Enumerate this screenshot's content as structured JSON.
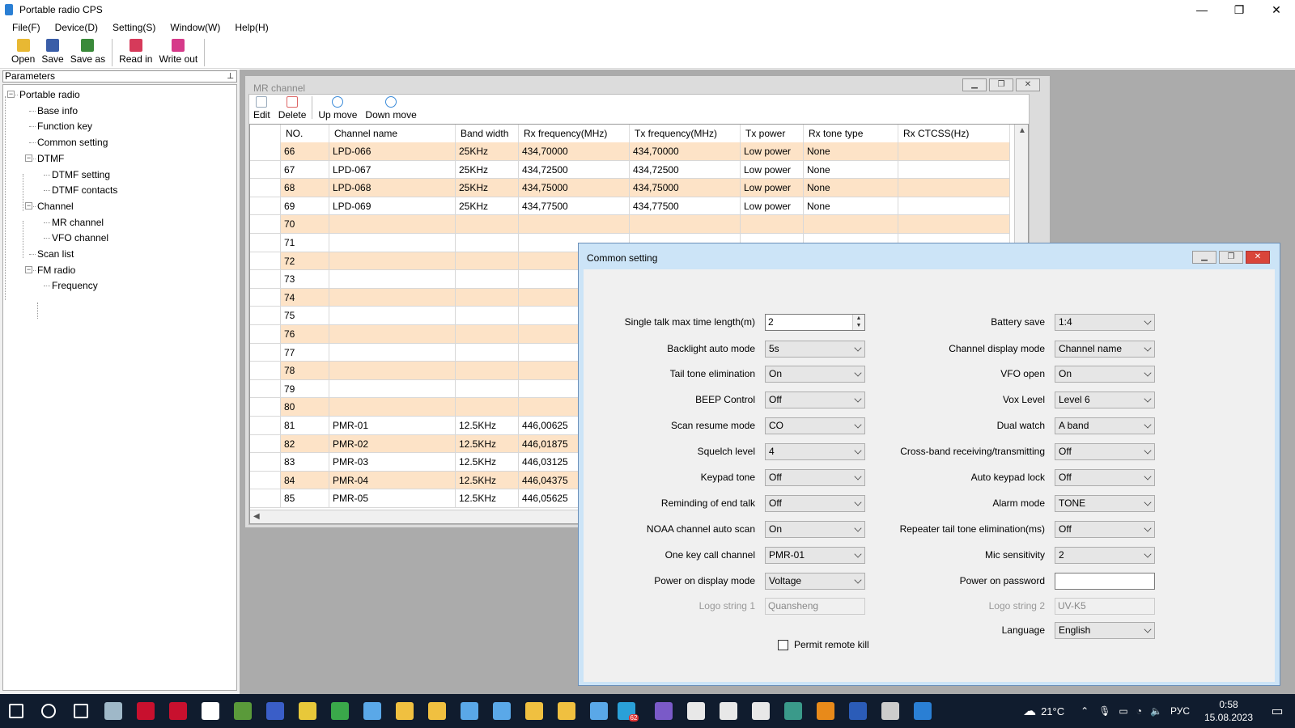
{
  "window": {
    "title": "Portable radio CPS",
    "controls": [
      "—",
      "❐",
      "✕"
    ]
  },
  "menu": [
    "File(F)",
    "Device(D)",
    "Setting(S)",
    "Window(W)",
    "Help(H)"
  ],
  "toolbar": {
    "file_buttons": [
      {
        "label": "Open",
        "icon": "folder-open-icon",
        "color": "#e8b833"
      },
      {
        "label": "Save",
        "icon": "floppy-disk-icon",
        "color": "#3a5ea8"
      },
      {
        "label": "Save as",
        "icon": "save-as-icon",
        "color": "#3a8a3a"
      }
    ],
    "device_buttons": [
      {
        "label": "Read in",
        "icon": "upload-icon",
        "color": "#d63a5a"
      },
      {
        "label": "Write out",
        "icon": "download-icon",
        "color": "#d63a8a"
      }
    ]
  },
  "parameters": {
    "header": "Parameters",
    "pin": "📌",
    "tree": [
      {
        "label": "Portable radio",
        "level": 0,
        "toggle": "-"
      },
      {
        "label": "Base info",
        "level": 1
      },
      {
        "label": "Function key",
        "level": 1
      },
      {
        "label": "Common setting",
        "level": 1
      },
      {
        "label": "DTMF",
        "level": 1,
        "toggle": "-"
      },
      {
        "label": "DTMF setting",
        "level": 2
      },
      {
        "label": "DTMF contacts",
        "level": 2
      },
      {
        "label": "Channel",
        "level": 1,
        "toggle": "-"
      },
      {
        "label": "MR channel",
        "level": 2
      },
      {
        "label": "VFO channel",
        "level": 2
      },
      {
        "label": "Scan list",
        "level": 1
      },
      {
        "label": "FM radio",
        "level": 1,
        "toggle": "-"
      },
      {
        "label": "Frequency",
        "level": 2
      }
    ]
  },
  "mr_channel": {
    "title": "MR channel",
    "toolbar": [
      {
        "label": "Edit",
        "icon": "edit-icon"
      },
      {
        "label": "Delete",
        "icon": "delete-icon"
      },
      {
        "label": "Up move",
        "icon": "arrow-up-circle-icon"
      },
      {
        "label": "Down move",
        "icon": "arrow-down-circle-icon"
      }
    ],
    "columns": [
      "NO.",
      "Channel name",
      "Band width",
      "Rx frequency(MHz)",
      "Tx frequency(MHz)",
      "Tx power",
      "Rx tone type",
      "Rx CTCSS(Hz)"
    ],
    "rows": [
      [
        "66",
        "LPD-066",
        "25KHz",
        "434,70000",
        "434,70000",
        "Low power",
        "None",
        ""
      ],
      [
        "67",
        "LPD-067",
        "25KHz",
        "434,72500",
        "434,72500",
        "Low power",
        "None",
        ""
      ],
      [
        "68",
        "LPD-068",
        "25KHz",
        "434,75000",
        "434,75000",
        "Low power",
        "None",
        ""
      ],
      [
        "69",
        "LPD-069",
        "25KHz",
        "434,77500",
        "434,77500",
        "Low power",
        "None",
        ""
      ],
      [
        "70",
        "",
        "",
        "",
        "",
        "",
        "",
        ""
      ],
      [
        "71",
        "",
        "",
        "",
        "",
        "",
        "",
        ""
      ],
      [
        "72",
        "",
        "",
        "",
        "",
        "",
        "",
        ""
      ],
      [
        "73",
        "",
        "",
        "",
        "",
        "",
        "",
        ""
      ],
      [
        "74",
        "",
        "",
        "",
        "",
        "",
        "",
        ""
      ],
      [
        "75",
        "",
        "",
        "",
        "",
        "",
        "",
        ""
      ],
      [
        "76",
        "",
        "",
        "",
        "",
        "",
        "",
        ""
      ],
      [
        "77",
        "",
        "",
        "",
        "",
        "",
        "",
        ""
      ],
      [
        "78",
        "",
        "",
        "",
        "",
        "",
        "",
        ""
      ],
      [
        "79",
        "",
        "",
        "",
        "",
        "",
        "",
        ""
      ],
      [
        "80",
        "",
        "",
        "",
        "",
        "",
        "",
        ""
      ],
      [
        "81",
        "PMR-01",
        "12.5KHz",
        "446,00625",
        "",
        "",
        "",
        ""
      ],
      [
        "82",
        "PMR-02",
        "12.5KHz",
        "446,01875",
        "",
        "",
        "",
        ""
      ],
      [
        "83",
        "PMR-03",
        "12.5KHz",
        "446,03125",
        "",
        "",
        "",
        ""
      ],
      [
        "84",
        "PMR-04",
        "12.5KHz",
        "446,04375",
        "",
        "",
        "",
        ""
      ],
      [
        "85",
        "PMR-05",
        "12.5KHz",
        "446,05625",
        "",
        "",
        "",
        ""
      ]
    ]
  },
  "common_setting": {
    "title": "Common setting",
    "left_fields": [
      {
        "label": "Single talk max time length(m)",
        "value": "2",
        "type": "spin"
      },
      {
        "label": "Backlight auto mode",
        "value": "5s",
        "type": "combo"
      },
      {
        "label": "Tail tone elimination",
        "value": "On",
        "type": "combo"
      },
      {
        "label": "BEEP Control",
        "value": "Off",
        "type": "combo"
      },
      {
        "label": "Scan resume mode",
        "value": "CO",
        "type": "combo"
      },
      {
        "label": "Squelch level",
        "value": "4",
        "type": "combo"
      },
      {
        "label": "Keypad tone",
        "value": "Off",
        "type": "combo"
      },
      {
        "label": "Reminding of end talk",
        "value": "Off",
        "type": "combo"
      },
      {
        "label": "NOAA channel auto scan",
        "value": "On",
        "type": "combo"
      },
      {
        "label": "One key call channel",
        "value": "PMR-01",
        "type": "combo"
      },
      {
        "label": "Power on display mode",
        "value": "Voltage",
        "type": "combo"
      },
      {
        "label": "Logo string 1",
        "value": "Quansheng",
        "type": "text-disabled"
      }
    ],
    "right_fields": [
      {
        "label": "Battery save",
        "value": "1:4",
        "type": "combo"
      },
      {
        "label": "Channel display mode",
        "value": "Channel name",
        "type": "combo"
      },
      {
        "label": "VFO open",
        "value": "On",
        "type": "combo"
      },
      {
        "label": "Vox Level",
        "value": "Level 6",
        "type": "combo"
      },
      {
        "label": "Dual watch",
        "value": "A band",
        "type": "combo"
      },
      {
        "label": "Cross-band receiving/transmitting",
        "value": "Off",
        "type": "combo"
      },
      {
        "label": "Auto keypad lock",
        "value": "Off",
        "type": "combo"
      },
      {
        "label": "Alarm mode",
        "value": "TONE",
        "type": "combo"
      },
      {
        "label": "Repeater tail tone elimination(ms)",
        "value": "Off",
        "type": "combo"
      },
      {
        "label": "Mic sensitivity",
        "value": "2",
        "type": "combo"
      },
      {
        "label": "Power on password",
        "value": "",
        "type": "text"
      },
      {
        "label": "Logo string 2",
        "value": "UV-K5",
        "type": "text-disabled"
      },
      {
        "label": "Language",
        "value": "English",
        "type": "combo"
      }
    ],
    "checkbox": {
      "label": "Permit remote kill",
      "checked": false
    }
  },
  "taskbar": {
    "apps": [
      {
        "icon": "windows-start-icon",
        "color": "#ffffff"
      },
      {
        "icon": "search-icon",
        "color": "#ffffff"
      },
      {
        "icon": "task-view-icon",
        "color": "#ffffff"
      },
      {
        "icon": "laptop-app-icon",
        "color": "#9fb8c8"
      },
      {
        "icon": "red-app-icon",
        "color": "#c8102e"
      },
      {
        "icon": "red-app-2-icon",
        "color": "#c8102e"
      },
      {
        "icon": "opera-icon",
        "color": "#ffffff"
      },
      {
        "icon": "spreadsheet-app-icon",
        "color": "#5a9a3a"
      },
      {
        "icon": "floppy-app-icon",
        "color": "#3a5ec8"
      },
      {
        "icon": "chrome-icon",
        "color": "#e8c83a"
      },
      {
        "icon": "chrome-2-icon",
        "color": "#3aa84a"
      },
      {
        "icon": "bird-app-icon",
        "color": "#5aa8e8"
      },
      {
        "icon": "folder-icon",
        "color": "#f0c040"
      },
      {
        "icon": "folder-2-icon",
        "color": "#f0c040"
      },
      {
        "icon": "bird-app-2-icon",
        "color": "#5aa8e8"
      },
      {
        "icon": "bird-app-3-icon",
        "color": "#5aa8e8"
      },
      {
        "icon": "folder-3-icon",
        "color": "#f0c040"
      },
      {
        "icon": "folder-4-icon",
        "color": "#f0c040"
      },
      {
        "icon": "bird-app-4-icon",
        "color": "#5aa8e8"
      },
      {
        "icon": "telegram-icon",
        "color": "#2aa0d8",
        "badge": "62"
      },
      {
        "icon": "viber-icon",
        "color": "#7a5ac8"
      },
      {
        "icon": "cube-app-icon",
        "color": "#e8e8e8"
      },
      {
        "icon": "cube-app-2-icon",
        "color": "#e8e8e8"
      },
      {
        "icon": "cube-app-3-icon",
        "color": "#e8e8e8"
      },
      {
        "icon": "chart-app-icon",
        "color": "#3a9a8a"
      },
      {
        "icon": "search-app-icon",
        "color": "#e88a1a"
      },
      {
        "icon": "word-icon",
        "color": "#2b5cb8"
      },
      {
        "icon": "printer-app-icon",
        "color": "#cccccc"
      },
      {
        "icon": "radio-cps-icon",
        "color": "#2a7fd4"
      }
    ],
    "weather": "21°C",
    "lang": "РУС",
    "time": "0:58",
    "date": "15.08.2023"
  }
}
